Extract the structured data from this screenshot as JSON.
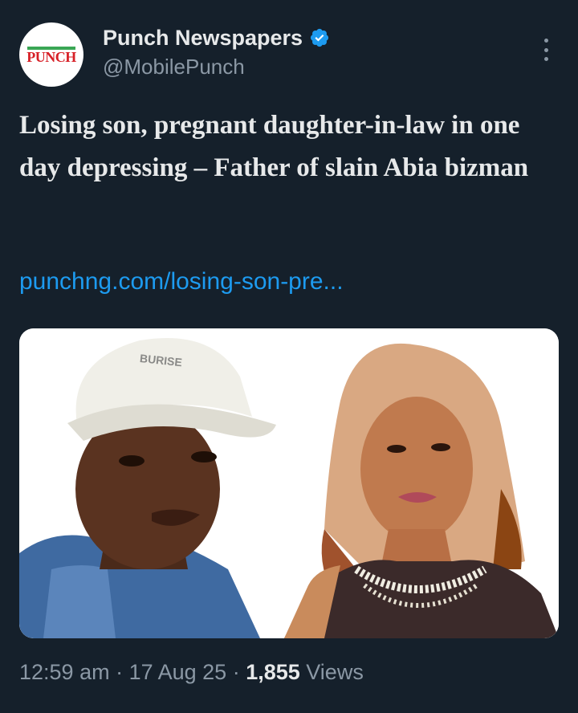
{
  "author": {
    "display_name": "Punch Newspapers",
    "handle": "@MobilePunch",
    "avatar_logo_text": "PUNCH",
    "verified_icon": "verified-badge-icon",
    "verified_color": "#1d9bf0"
  },
  "tweet": {
    "headline": "Losing son, pregnant daughter-in-law in one day depressing – Father of slain Abia bizman",
    "link_text": "punchng.com/losing-son-pre...",
    "media": {
      "cap_text": "BURISE",
      "icon": "photo"
    }
  },
  "meta": {
    "time": "12:59 am",
    "sep1": " · ",
    "date": "17 Aug 25",
    "sep2": " · ",
    "views_count": "1,855",
    "views_label": " Views"
  },
  "colors": {
    "background": "#15202b",
    "text": "#e7e9ea",
    "secondary_text": "#8b98a5",
    "link": "#1d9bf0"
  }
}
